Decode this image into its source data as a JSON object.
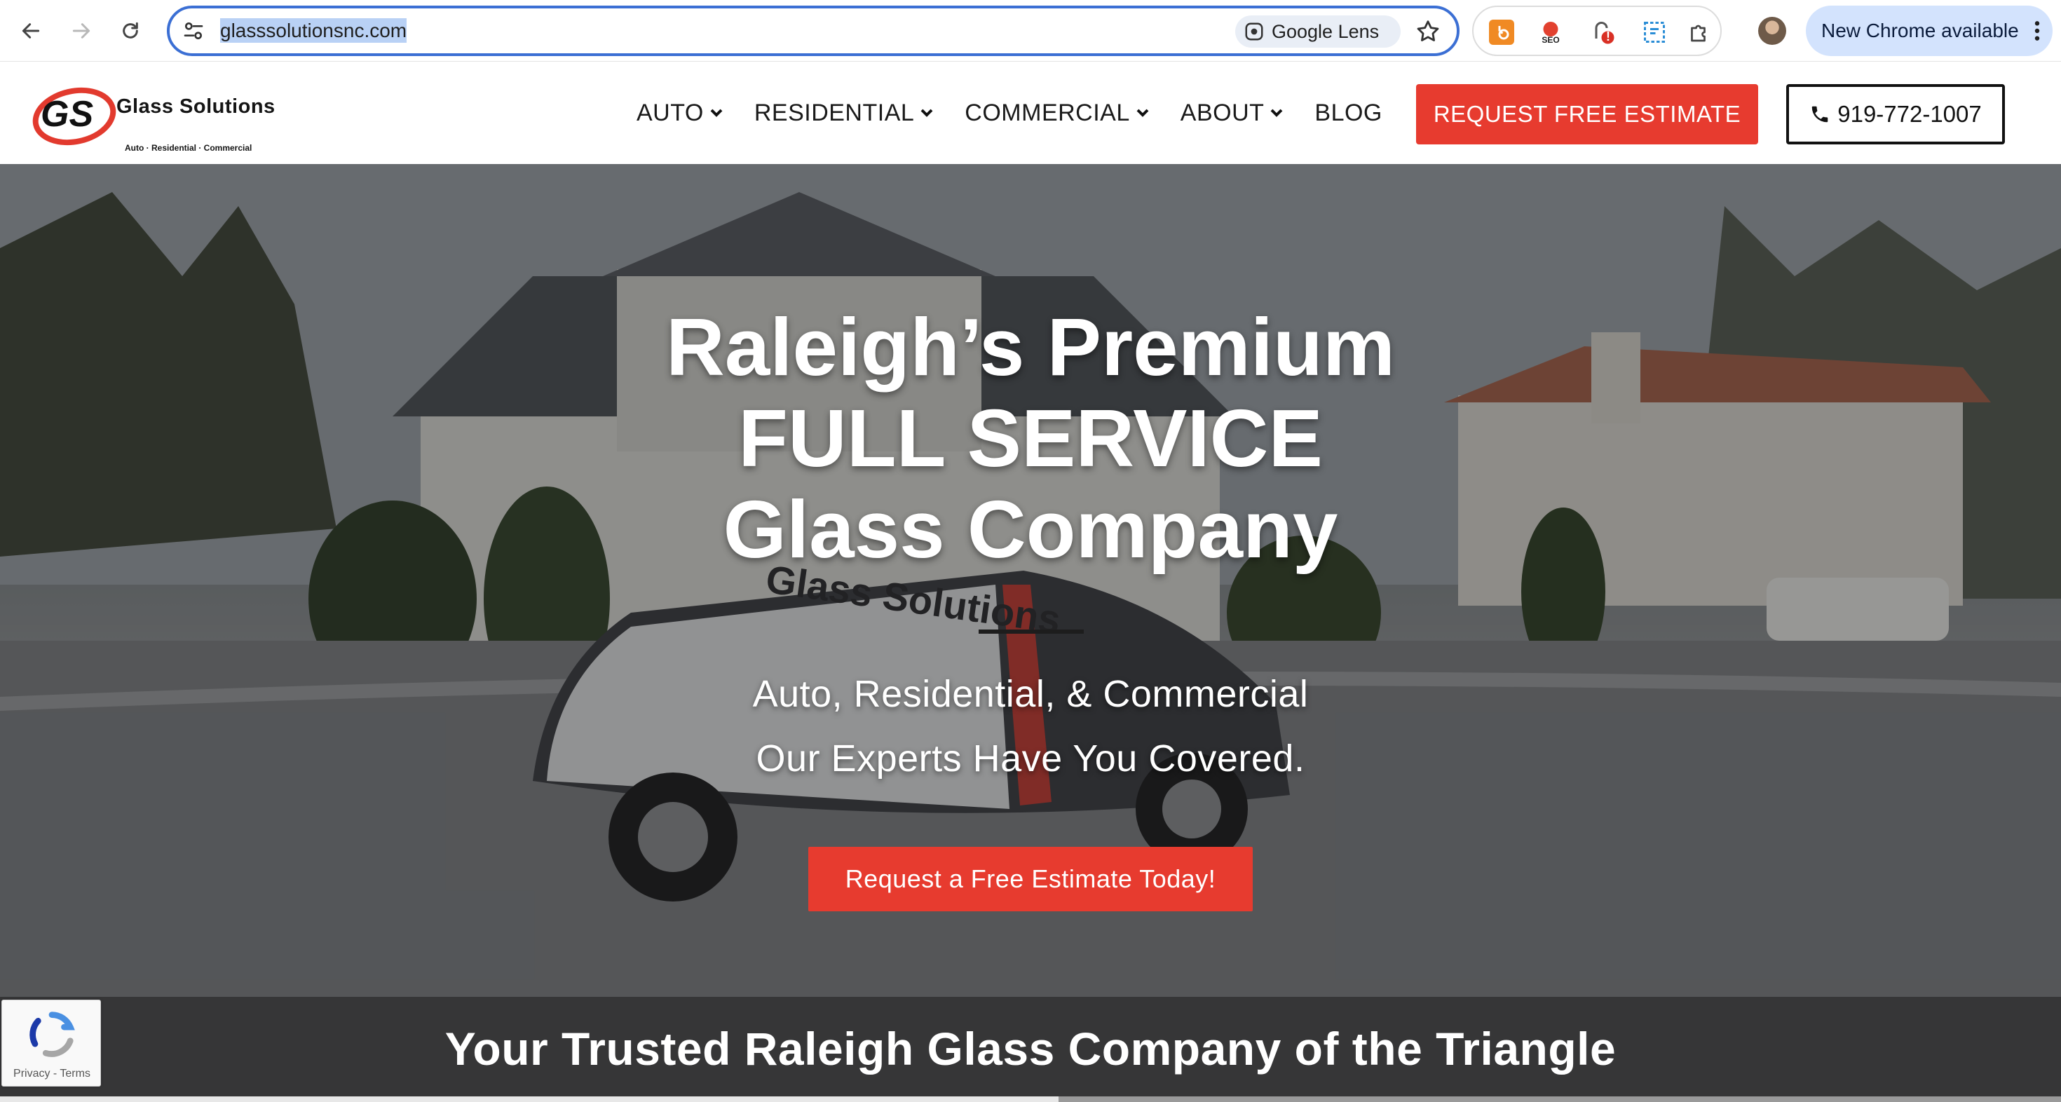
{
  "browser": {
    "url": "glasssolutionsnc.com",
    "lens_label": "Google Lens",
    "update_label": "New Chrome available",
    "extensions": [
      "hubspot-extension",
      "seo-extension",
      "alert-extension",
      "capture-extension",
      "puzzle-extension"
    ],
    "extension_badge": "!"
  },
  "site": {
    "logo_mark": "GS",
    "logo_name": "Glass Solutions",
    "logo_tagline": "Auto · Residential · Commercial",
    "nav": [
      {
        "label": "AUTO",
        "dropdown": true
      },
      {
        "label": "RESIDENTIAL",
        "dropdown": true
      },
      {
        "label": "COMMERCIAL",
        "dropdown": true
      },
      {
        "label": "ABOUT",
        "dropdown": true
      },
      {
        "label": "BLOG",
        "dropdown": false
      }
    ],
    "estimate_button": "REQUEST FREE ESTIMATE",
    "phone": "919-772-1007",
    "accent_color": "#e73b2f"
  },
  "hero": {
    "title_lines": [
      "Raleigh’s Premium",
      "FULL SERVICE",
      "Glass Company"
    ],
    "subtitle_lines": [
      "Auto, Residential, & Commercial",
      "Our Experts Have You Covered."
    ],
    "cta": "Request a Free Estimate Today!",
    "vehicle_text": "Glass Solutions"
  },
  "band": {
    "title": "Your Trusted Raleigh Glass Company of the Triangle"
  },
  "recaptcha": {
    "privacy": "Privacy",
    "separator": " - ",
    "terms": "Terms"
  }
}
